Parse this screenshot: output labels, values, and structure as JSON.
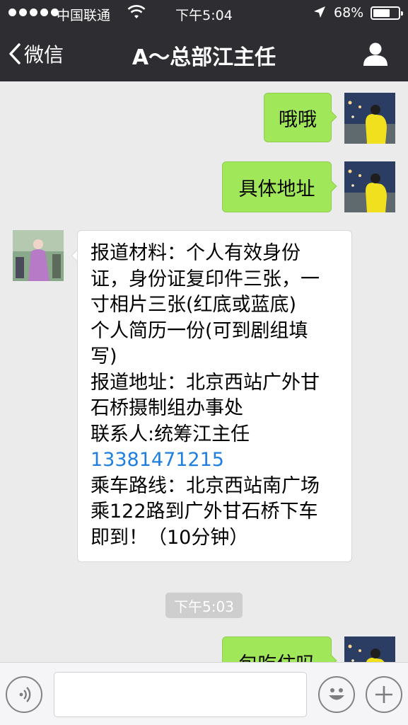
{
  "status_bar": {
    "carrier": "中国联通",
    "time": "下午5:04",
    "battery": "68%",
    "battery_level": 0.68,
    "signal_dots": 5
  },
  "nav": {
    "back_label": "微信",
    "title": "A～总部江主任"
  },
  "messages": [
    {
      "side": "right",
      "text": "哦哦"
    },
    {
      "side": "right",
      "text": "具体地址"
    },
    {
      "side": "left",
      "lines": [
        "报道材料：个人有效身份",
        "证，身份证复印件三张，一",
        "寸相片三张(红底或蓝底)",
        "个人简历一份(可到剧组填",
        "写)",
        "报道地址：北京西站广外甘",
        "石桥摄制组办事处",
        "联系人:统筹江主任",
        "13381471215",
        "乘车路线：北京西站南广场",
        "乘122路到广外甘石桥下车",
        "即到！（10分钟）"
      ]
    },
    {
      "side": "right",
      "text": "包吃住吗"
    }
  ],
  "timestamp": "下午5:03",
  "colors": {
    "bar_bg": "#2e2e32",
    "chat_bg": "#ebebeb",
    "green_bubble": "#a0e75a",
    "link_blue": "#1f7fe0"
  },
  "icons": [
    "signal-dots-icon",
    "wifi-icon",
    "location-arrow-icon",
    "battery-icon",
    "back-chevron-icon",
    "person-icon",
    "voice-icon",
    "emoji-icon",
    "plus-icon"
  ]
}
